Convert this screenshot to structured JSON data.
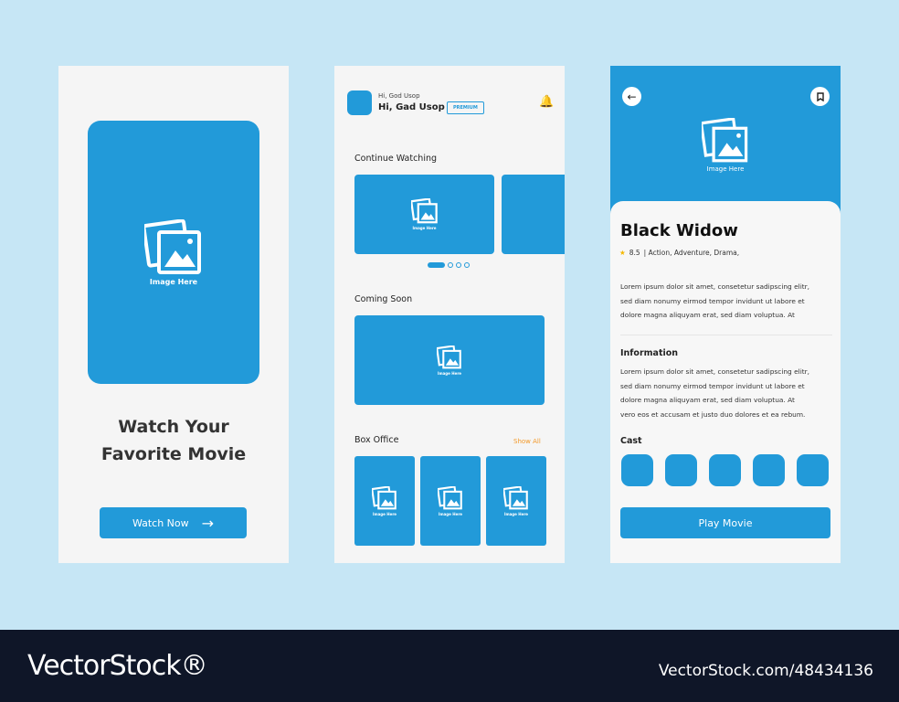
{
  "colors": {
    "accent": "#229ad9",
    "background": "#c6e6f5",
    "orange": "#f39a2b"
  },
  "onboarding": {
    "image_label": "Image Here",
    "title_line1": "Watch Your",
    "title_line2": "Favorite Movie",
    "button": "Watch Now",
    "button_icon": "arrow-right-icon"
  },
  "home": {
    "greeting_small": "Hi, God Usop",
    "greeting": "Hi, Gad Usop",
    "badge": "PREMIUM",
    "bell_icon": "bell-icon",
    "continue_watching": "Continue Watching",
    "coming_soon": "Coming Soon",
    "box_office": "Box Office",
    "show_all": "Show All",
    "image_label": "Image Here",
    "carousel_active_index": 0,
    "carousel_count": 4
  },
  "detail": {
    "image_label": "Image Here",
    "title": "Black Widow",
    "rating": "8.5",
    "genres": "| Action, Adventure, Drama,",
    "description": [
      "Lorem ipsum dolor sit amet, consetetur sadipscing elitr,",
      "sed diam nonumy eirmod tempor invidunt ut labore et",
      "dolore magna aliquyam erat, sed diam voluptua. At"
    ],
    "info_title": "Information",
    "info": [
      "Lorem ipsum dolor sit amet, consetetur sadipscing elitr,",
      "sed diam nonumy eirmod tempor invidunt ut labore et",
      "dolore magna aliquyam erat, sed diam voluptua. At",
      "vero eos et accusam et justo duo dolores et ea rebum."
    ],
    "cast_title": "Cast",
    "cast_count": 5,
    "play_button": "Play Movie"
  },
  "footer": {
    "logo": "VectorStock®",
    "id": "VectorStock.com/48434136"
  }
}
